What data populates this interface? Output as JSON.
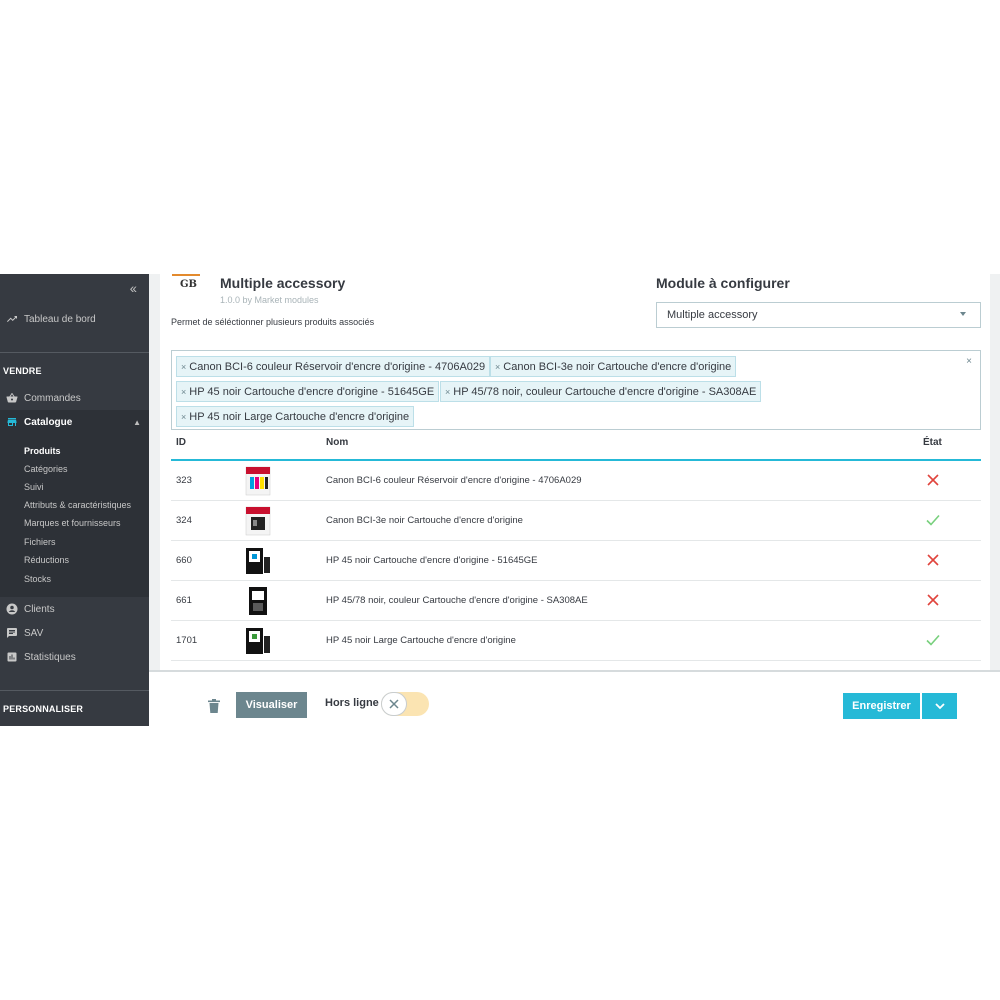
{
  "sidebar": {
    "collapse_icon": "double-chevron-left-icon",
    "dashboard": "Tableau de bord",
    "section_sell": "VENDRE",
    "orders": "Commandes",
    "catalog": "Catalogue",
    "catalog_sub": [
      "Produits",
      "Catégories",
      "Suivi",
      "Attributs & caractéristiques",
      "Marques et fournisseurs",
      "Fichiers",
      "Réductions",
      "Stocks"
    ],
    "customers": "Clients",
    "support": "SAV",
    "stats": "Statistiques",
    "section_customize": "PERSONNALISER"
  },
  "module": {
    "logo_text": "GB",
    "title": "Multiple accessory",
    "version": "1.0.0 by Market modules",
    "description": "Permet de séléctionner plusieurs produits associés"
  },
  "config": {
    "title": "Module à configurer",
    "selected": "Multiple accessory"
  },
  "tags": [
    "Canon BCI-6 couleur Réservoir d'encre d'origine - 4706A029",
    "Canon BCI-3e noir Cartouche d'encre d'origine",
    "HP 45 noir Cartouche d'encre d'origine - 51645GE",
    "HP 45/78 noir, couleur Cartouche d'encre d'origine - SA308AE",
    "HP 45 noir Large Cartouche d'encre d'origine"
  ],
  "table": {
    "headers": {
      "id": "ID",
      "name": "Nom",
      "state": "État"
    },
    "rows": [
      {
        "id": "323",
        "name": "Canon BCI-6 couleur Réservoir d'encre d'origine - 4706A029",
        "state": "disabled"
      },
      {
        "id": "324",
        "name": "Canon BCI-3e noir Cartouche d'encre d'origine",
        "state": "enabled"
      },
      {
        "id": "660",
        "name": "HP 45 noir Cartouche d'encre d'origine - 51645GE",
        "state": "disabled"
      },
      {
        "id": "661",
        "name": "HP 45/78 noir, couleur Cartouche d'encre d'origine - SA308AE",
        "state": "disabled"
      },
      {
        "id": "1701",
        "name": "HP 45 noir Large Cartouche d'encre d'origine",
        "state": "enabled"
      }
    ]
  },
  "footer": {
    "preview": "Visualiser",
    "offline": "Hors ligne",
    "save": "Enregistrer"
  },
  "colors": {
    "accent": "#25b9d7",
    "sidebar": "#363a41",
    "enabled": "#78d07d",
    "disabled": "#e0443d",
    "toggle_off": "#fbe4b2"
  }
}
